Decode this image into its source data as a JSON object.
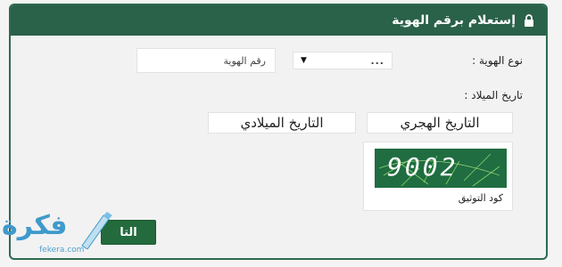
{
  "header": {
    "title": "إستعلام برقم الهوية",
    "icon": "lock-icon"
  },
  "form": {
    "id_type_label": "نوع الهوية :",
    "id_type_value": "...",
    "id_number_placeholder": "رقم الهوية",
    "birth_date_label": "تاريخ الميلاد :",
    "hijri_label": "التاريخ الهجري",
    "gregorian_label": "التاريخ الميلادي",
    "captcha_value": "9002",
    "captcha_label": "كود التوثيق",
    "submit_label": "التا"
  },
  "watermark": {
    "brand": "فكرة",
    "site": "fekera.com"
  },
  "colors": {
    "header": "#2a6149",
    "button": "#236b3d",
    "captcha_bg": "#1f6d41",
    "logo": "#3f9acb"
  }
}
